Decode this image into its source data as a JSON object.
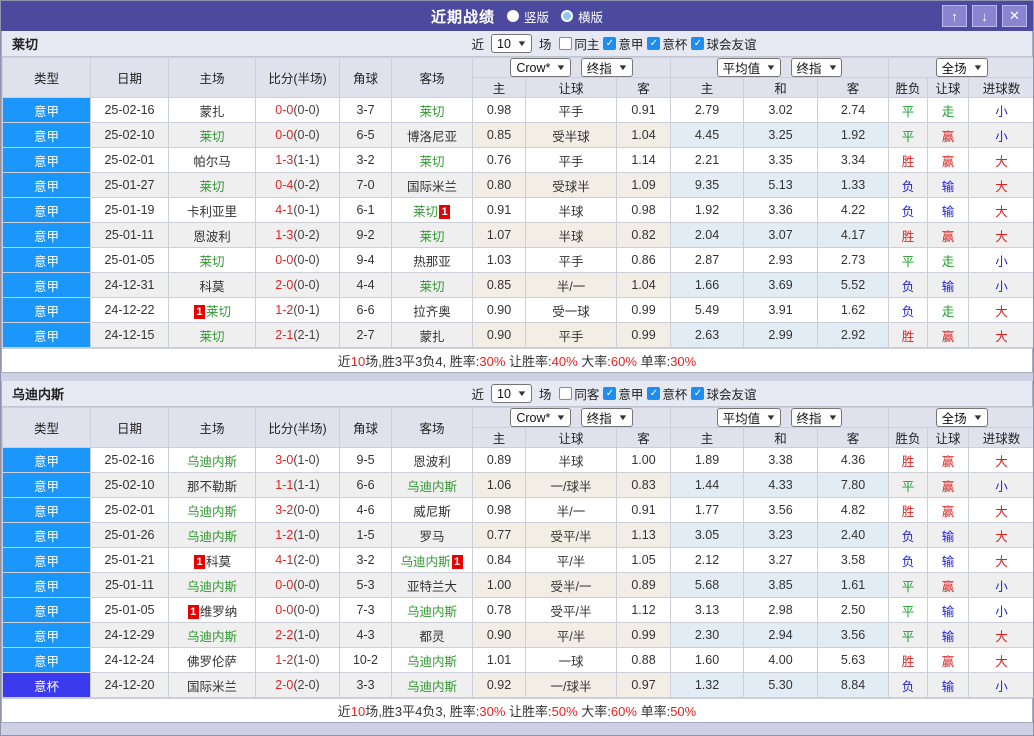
{
  "titlebar": {
    "title": "近期战绩",
    "vertical_label": "竖版",
    "horizontal_label": "横版",
    "selected_mode": "竖版",
    "up_icon": "↑",
    "down_icon": "↓",
    "close_icon": "✕",
    "bar_color": "#4b4a9e"
  },
  "header_labels": {
    "col_type": "类型",
    "col_date": "日期",
    "col_home": "主场",
    "col_score": "比分(半场)",
    "col_corner": "角球",
    "col_away": "客场",
    "crow_select": "Crow*",
    "final_select": "终指",
    "avg_select": "平均值",
    "full_select": "全场",
    "sub_home": "主",
    "sub_handicap": "让球",
    "sub_away": "客",
    "sub_avg_home": "主",
    "sub_avg_draw": "和",
    "sub_avg_away": "客",
    "sub_result": "胜负",
    "sub_result_handicap": "让球",
    "sub_goals": "进球数"
  },
  "filter": {
    "near": "近",
    "count": "10",
    "games": "场",
    "leagues": [
      "意甲",
      "意杯",
      "球会友谊"
    ],
    "checkbox_check_icon": "✓"
  },
  "card_label": "1",
  "league_colors": {
    "意甲": "#1b96fb",
    "意杯": "#3c3aef"
  },
  "result_colors": {
    "胜": "#dd2222",
    "平": "#18a028",
    "负": "#2222dd",
    "赢": "#dd2222",
    "走": "#18a028",
    "输": "#2222dd",
    "大": "#dd2222",
    "小": "#2222dd"
  },
  "tables": [
    {
      "team": "莱切",
      "same_filter": "同主",
      "same_checked": false,
      "rows": [
        {
          "league": "意甲",
          "date": "25-02-16",
          "home": "蒙扎",
          "home_is_team": false,
          "home_card": false,
          "score": "0-0",
          "half": "(0-0)",
          "corners": "3-7",
          "away": "莱切",
          "away_is_team": true,
          "away_card": false,
          "odds": [
            "0.98",
            "平手",
            "0.91"
          ],
          "avg": [
            "2.79",
            "3.02",
            "2.74"
          ],
          "results": [
            "平",
            "走",
            "小"
          ]
        },
        {
          "league": "意甲",
          "date": "25-02-10",
          "home": "莱切",
          "home_is_team": true,
          "home_card": false,
          "score": "0-0",
          "half": "(0-0)",
          "corners": "6-5",
          "away": "博洛尼亚",
          "away_is_team": false,
          "away_card": false,
          "odds": [
            "0.85",
            "受半球",
            "1.04"
          ],
          "avg": [
            "4.45",
            "3.25",
            "1.92"
          ],
          "results": [
            "平",
            "赢",
            "小"
          ]
        },
        {
          "league": "意甲",
          "date": "25-02-01",
          "home": "帕尔马",
          "home_is_team": false,
          "home_card": false,
          "score": "1-3",
          "half": "(1-1)",
          "corners": "3-2",
          "away": "莱切",
          "away_is_team": true,
          "away_card": false,
          "odds": [
            "0.76",
            "平手",
            "1.14"
          ],
          "avg": [
            "2.21",
            "3.35",
            "3.34"
          ],
          "results": [
            "胜",
            "赢",
            "大"
          ]
        },
        {
          "league": "意甲",
          "date": "25-01-27",
          "home": "莱切",
          "home_is_team": true,
          "home_card": false,
          "score": "0-4",
          "half": "(0-2)",
          "corners": "7-0",
          "away": "国际米兰",
          "away_is_team": false,
          "away_card": false,
          "odds": [
            "0.80",
            "受球半",
            "1.09"
          ],
          "avg": [
            "9.35",
            "5.13",
            "1.33"
          ],
          "results": [
            "负",
            "输",
            "大"
          ]
        },
        {
          "league": "意甲",
          "date": "25-01-19",
          "home": "卡利亚里",
          "home_is_team": false,
          "home_card": false,
          "score": "4-1",
          "half": "(0-1)",
          "corners": "6-1",
          "away": "莱切",
          "away_is_team": true,
          "away_card": true,
          "odds": [
            "0.91",
            "半球",
            "0.98"
          ],
          "avg": [
            "1.92",
            "3.36",
            "4.22"
          ],
          "results": [
            "负",
            "输",
            "大"
          ]
        },
        {
          "league": "意甲",
          "date": "25-01-11",
          "home": "恩波利",
          "home_is_team": false,
          "home_card": false,
          "score": "1-3",
          "half": "(0-2)",
          "corners": "9-2",
          "away": "莱切",
          "away_is_team": true,
          "away_card": false,
          "odds": [
            "1.07",
            "半球",
            "0.82"
          ],
          "avg": [
            "2.04",
            "3.07",
            "4.17"
          ],
          "results": [
            "胜",
            "赢",
            "大"
          ]
        },
        {
          "league": "意甲",
          "date": "25-01-05",
          "home": "莱切",
          "home_is_team": true,
          "home_card": false,
          "score": "0-0",
          "half": "(0-0)",
          "corners": "9-4",
          "away": "热那亚",
          "away_is_team": false,
          "away_card": false,
          "odds": [
            "1.03",
            "平手",
            "0.86"
          ],
          "avg": [
            "2.87",
            "2.93",
            "2.73"
          ],
          "results": [
            "平",
            "走",
            "小"
          ]
        },
        {
          "league": "意甲",
          "date": "24-12-31",
          "home": "科莫",
          "home_is_team": false,
          "home_card": false,
          "score": "2-0",
          "half": "(0-0)",
          "corners": "4-4",
          "away": "莱切",
          "away_is_team": true,
          "away_card": false,
          "odds": [
            "0.85",
            "半/一",
            "1.04"
          ],
          "avg": [
            "1.66",
            "3.69",
            "5.52"
          ],
          "results": [
            "负",
            "输",
            "小"
          ]
        },
        {
          "league": "意甲",
          "date": "24-12-22",
          "home": "莱切",
          "home_is_team": true,
          "home_card": true,
          "score": "1-2",
          "half": "(0-1)",
          "corners": "6-6",
          "away": "拉齐奥",
          "away_is_team": false,
          "away_card": false,
          "odds": [
            "0.90",
            "受一球",
            "0.99"
          ],
          "avg": [
            "5.49",
            "3.91",
            "1.62"
          ],
          "results": [
            "负",
            "走",
            "大"
          ]
        },
        {
          "league": "意甲",
          "date": "24-12-15",
          "home": "莱切",
          "home_is_team": true,
          "home_card": false,
          "score": "2-1",
          "half": "(2-1)",
          "corners": "2-7",
          "away": "蒙扎",
          "away_is_team": false,
          "away_card": false,
          "odds": [
            "0.90",
            "平手",
            "0.99"
          ],
          "avg": [
            "2.63",
            "2.99",
            "2.92"
          ],
          "results": [
            "胜",
            "赢",
            "大"
          ]
        }
      ],
      "summary": [
        [
          "近",
          false
        ],
        [
          "10",
          true
        ],
        [
          "场,胜3平3负4, 胜率:",
          false
        ],
        [
          "30%",
          true
        ],
        [
          " 让胜率:",
          false
        ],
        [
          "40%",
          true
        ],
        [
          " 大率:",
          false
        ],
        [
          "60%",
          true
        ],
        [
          " 单率:",
          false
        ],
        [
          "30%",
          true
        ]
      ]
    },
    {
      "team": "乌迪内斯",
      "same_filter": "同客",
      "same_checked": false,
      "rows": [
        {
          "league": "意甲",
          "date": "25-02-16",
          "home": "乌迪内斯",
          "home_is_team": true,
          "home_card": false,
          "score": "3-0",
          "half": "(1-0)",
          "corners": "9-5",
          "away": "恩波利",
          "away_is_team": false,
          "away_card": false,
          "odds": [
            "0.89",
            "半球",
            "1.00"
          ],
          "avg": [
            "1.89",
            "3.38",
            "4.36"
          ],
          "results": [
            "胜",
            "赢",
            "大"
          ]
        },
        {
          "league": "意甲",
          "date": "25-02-10",
          "home": "那不勒斯",
          "home_is_team": false,
          "home_card": false,
          "score": "1-1",
          "half": "(1-1)",
          "corners": "6-6",
          "away": "乌迪内斯",
          "away_is_team": true,
          "away_card": false,
          "odds": [
            "1.06",
            "一/球半",
            "0.83"
          ],
          "avg": [
            "1.44",
            "4.33",
            "7.80"
          ],
          "results": [
            "平",
            "赢",
            "小"
          ]
        },
        {
          "league": "意甲",
          "date": "25-02-01",
          "home": "乌迪内斯",
          "home_is_team": true,
          "home_card": false,
          "score": "3-2",
          "half": "(0-0)",
          "corners": "4-6",
          "away": "威尼斯",
          "away_is_team": false,
          "away_card": false,
          "odds": [
            "0.98",
            "半/一",
            "0.91"
          ],
          "avg": [
            "1.77",
            "3.56",
            "4.82"
          ],
          "results": [
            "胜",
            "赢",
            "大"
          ]
        },
        {
          "league": "意甲",
          "date": "25-01-26",
          "home": "乌迪内斯",
          "home_is_team": true,
          "home_card": false,
          "score": "1-2",
          "half": "(1-0)",
          "corners": "1-5",
          "away": "罗马",
          "away_is_team": false,
          "away_card": false,
          "odds": [
            "0.77",
            "受平/半",
            "1.13"
          ],
          "avg": [
            "3.05",
            "3.23",
            "2.40"
          ],
          "results": [
            "负",
            "输",
            "大"
          ]
        },
        {
          "league": "意甲",
          "date": "25-01-21",
          "home": "科莫",
          "home_is_team": false,
          "home_card": true,
          "score": "4-1",
          "half": "(2-0)",
          "corners": "3-2",
          "away": "乌迪内斯",
          "away_is_team": true,
          "away_card": true,
          "odds": [
            "0.84",
            "平/半",
            "1.05"
          ],
          "avg": [
            "2.12",
            "3.27",
            "3.58"
          ],
          "results": [
            "负",
            "输",
            "大"
          ]
        },
        {
          "league": "意甲",
          "date": "25-01-11",
          "home": "乌迪内斯",
          "home_is_team": true,
          "home_card": false,
          "score": "0-0",
          "half": "(0-0)",
          "corners": "5-3",
          "away": "亚特兰大",
          "away_is_team": false,
          "away_card": false,
          "odds": [
            "1.00",
            "受半/一",
            "0.89"
          ],
          "avg": [
            "5.68",
            "3.85",
            "1.61"
          ],
          "results": [
            "平",
            "赢",
            "小"
          ]
        },
        {
          "league": "意甲",
          "date": "25-01-05",
          "home": "维罗纳",
          "home_is_team": false,
          "home_card": true,
          "score": "0-0",
          "half": "(0-0)",
          "corners": "7-3",
          "away": "乌迪内斯",
          "away_is_team": true,
          "away_card": false,
          "odds": [
            "0.78",
            "受平/半",
            "1.12"
          ],
          "avg": [
            "3.13",
            "2.98",
            "2.50"
          ],
          "results": [
            "平",
            "输",
            "小"
          ]
        },
        {
          "league": "意甲",
          "date": "24-12-29",
          "home": "乌迪内斯",
          "home_is_team": true,
          "home_card": false,
          "score": "2-2",
          "half": "(1-0)",
          "corners": "4-3",
          "away": "都灵",
          "away_is_team": false,
          "away_card": false,
          "odds": [
            "0.90",
            "平/半",
            "0.99"
          ],
          "avg": [
            "2.30",
            "2.94",
            "3.56"
          ],
          "results": [
            "平",
            "输",
            "大"
          ]
        },
        {
          "league": "意甲",
          "date": "24-12-24",
          "home": "佛罗伦萨",
          "home_is_team": false,
          "home_card": false,
          "score": "1-2",
          "half": "(1-0)",
          "corners": "10-2",
          "away": "乌迪内斯",
          "away_is_team": true,
          "away_card": false,
          "odds": [
            "1.01",
            "一球",
            "0.88"
          ],
          "avg": [
            "1.60",
            "4.00",
            "5.63"
          ],
          "results": [
            "胜",
            "赢",
            "大"
          ]
        },
        {
          "league": "意杯",
          "date": "24-12-20",
          "home": "国际米兰",
          "home_is_team": false,
          "home_card": false,
          "score": "2-0",
          "half": "(2-0)",
          "corners": "3-3",
          "away": "乌迪内斯",
          "away_is_team": true,
          "away_card": false,
          "odds": [
            "0.92",
            "一/球半",
            "0.97"
          ],
          "avg": [
            "1.32",
            "5.30",
            "8.84"
          ],
          "results": [
            "负",
            "输",
            "小"
          ]
        }
      ],
      "summary": [
        [
          "近",
          false
        ],
        [
          "10",
          true
        ],
        [
          "场,胜3平4负3, 胜率:",
          false
        ],
        [
          "30%",
          true
        ],
        [
          " 让胜率:",
          false
        ],
        [
          "50%",
          true
        ],
        [
          " 大率:",
          false
        ],
        [
          "60%",
          true
        ],
        [
          " 单率:",
          false
        ],
        [
          "50%",
          true
        ]
      ]
    }
  ]
}
